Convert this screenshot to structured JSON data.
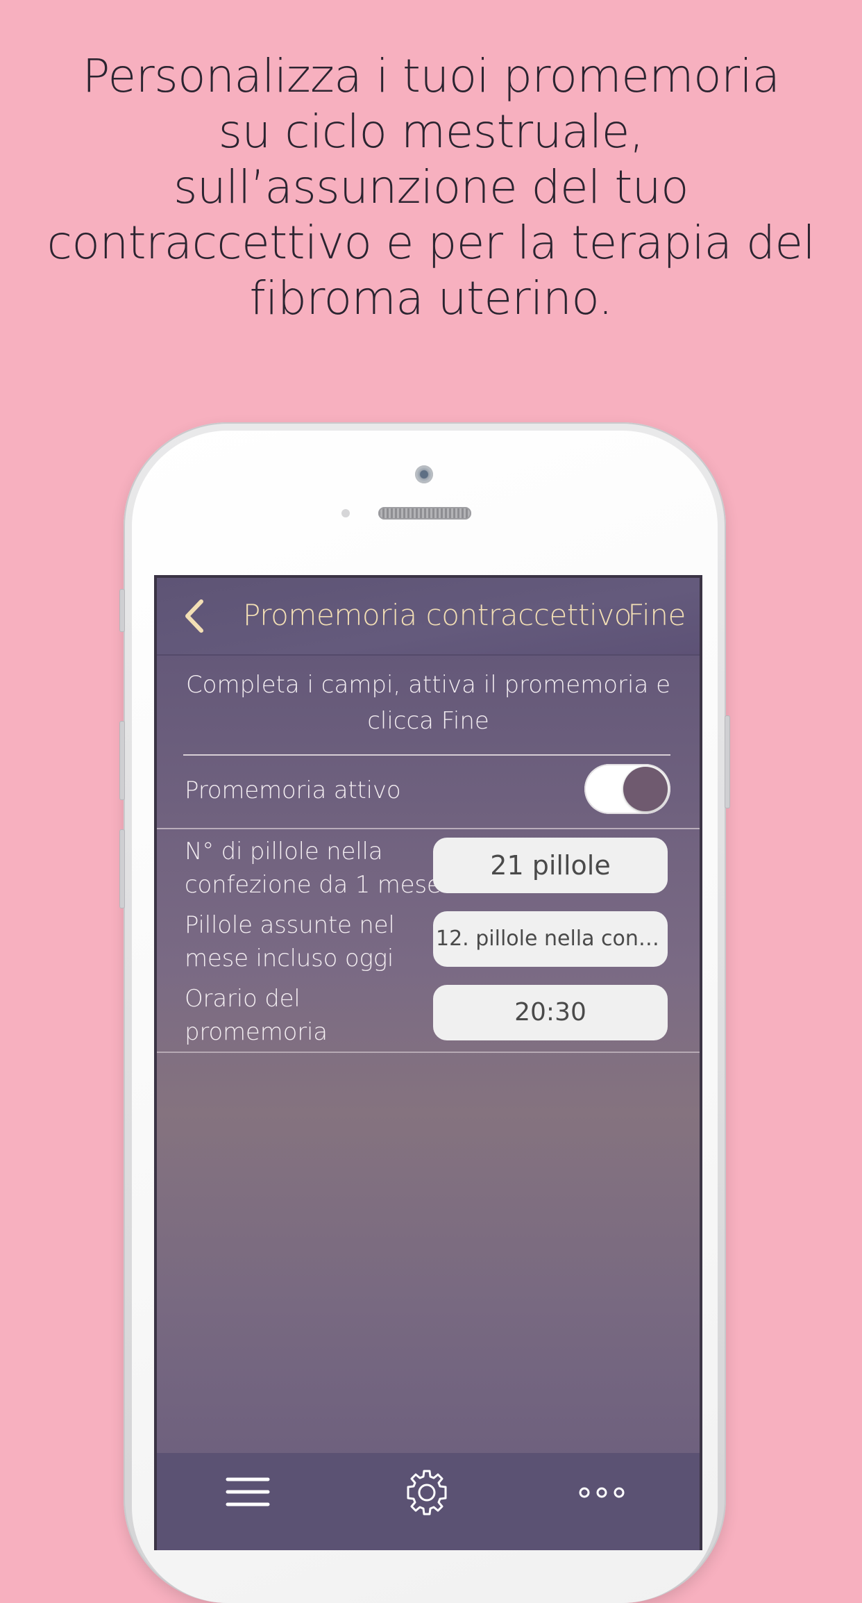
{
  "headline": {
    "line1": "Personalizza i tuoi promemoria",
    "line2": "su ciclo mestruale,",
    "line3": "sull’assunzione del tuo",
    "line4": "contraccettivo e per la terapia del",
    "line5": "fibroma uterino."
  },
  "navbar": {
    "title": "Promemoria contraccettivo",
    "done_label": "Fine",
    "back_icon": "chevron-left-icon"
  },
  "instructions": {
    "line1": "Completa i campi, attiva il promemoria e",
    "line2": "clicca Fine"
  },
  "reminder_toggle": {
    "label": "Promemoria attivo",
    "on": true
  },
  "pills_per_pack": {
    "label_line1": "N° di pillole nella",
    "label_line2": "confezione da 1 mese",
    "value": "21 pillole"
  },
  "pills_taken": {
    "label_line1": "Pillole assunte nel",
    "label_line2": "mese incluso oggi",
    "value": "12. pillole nella confe…"
  },
  "reminder_time": {
    "label_line1": "Orario del",
    "label_line2": "promemoria",
    "value": "20:30"
  },
  "tabbar": {
    "menu_icon": "hamburger-menu-icon",
    "settings_icon": "gear-icon",
    "more_icon": "more-dots-icon"
  },
  "colors": {
    "background": "#f7b0bf",
    "accent_title": "#f3dfb5",
    "screen_purple": "#5f5476",
    "toggle_knob": "#6f5a6f"
  }
}
